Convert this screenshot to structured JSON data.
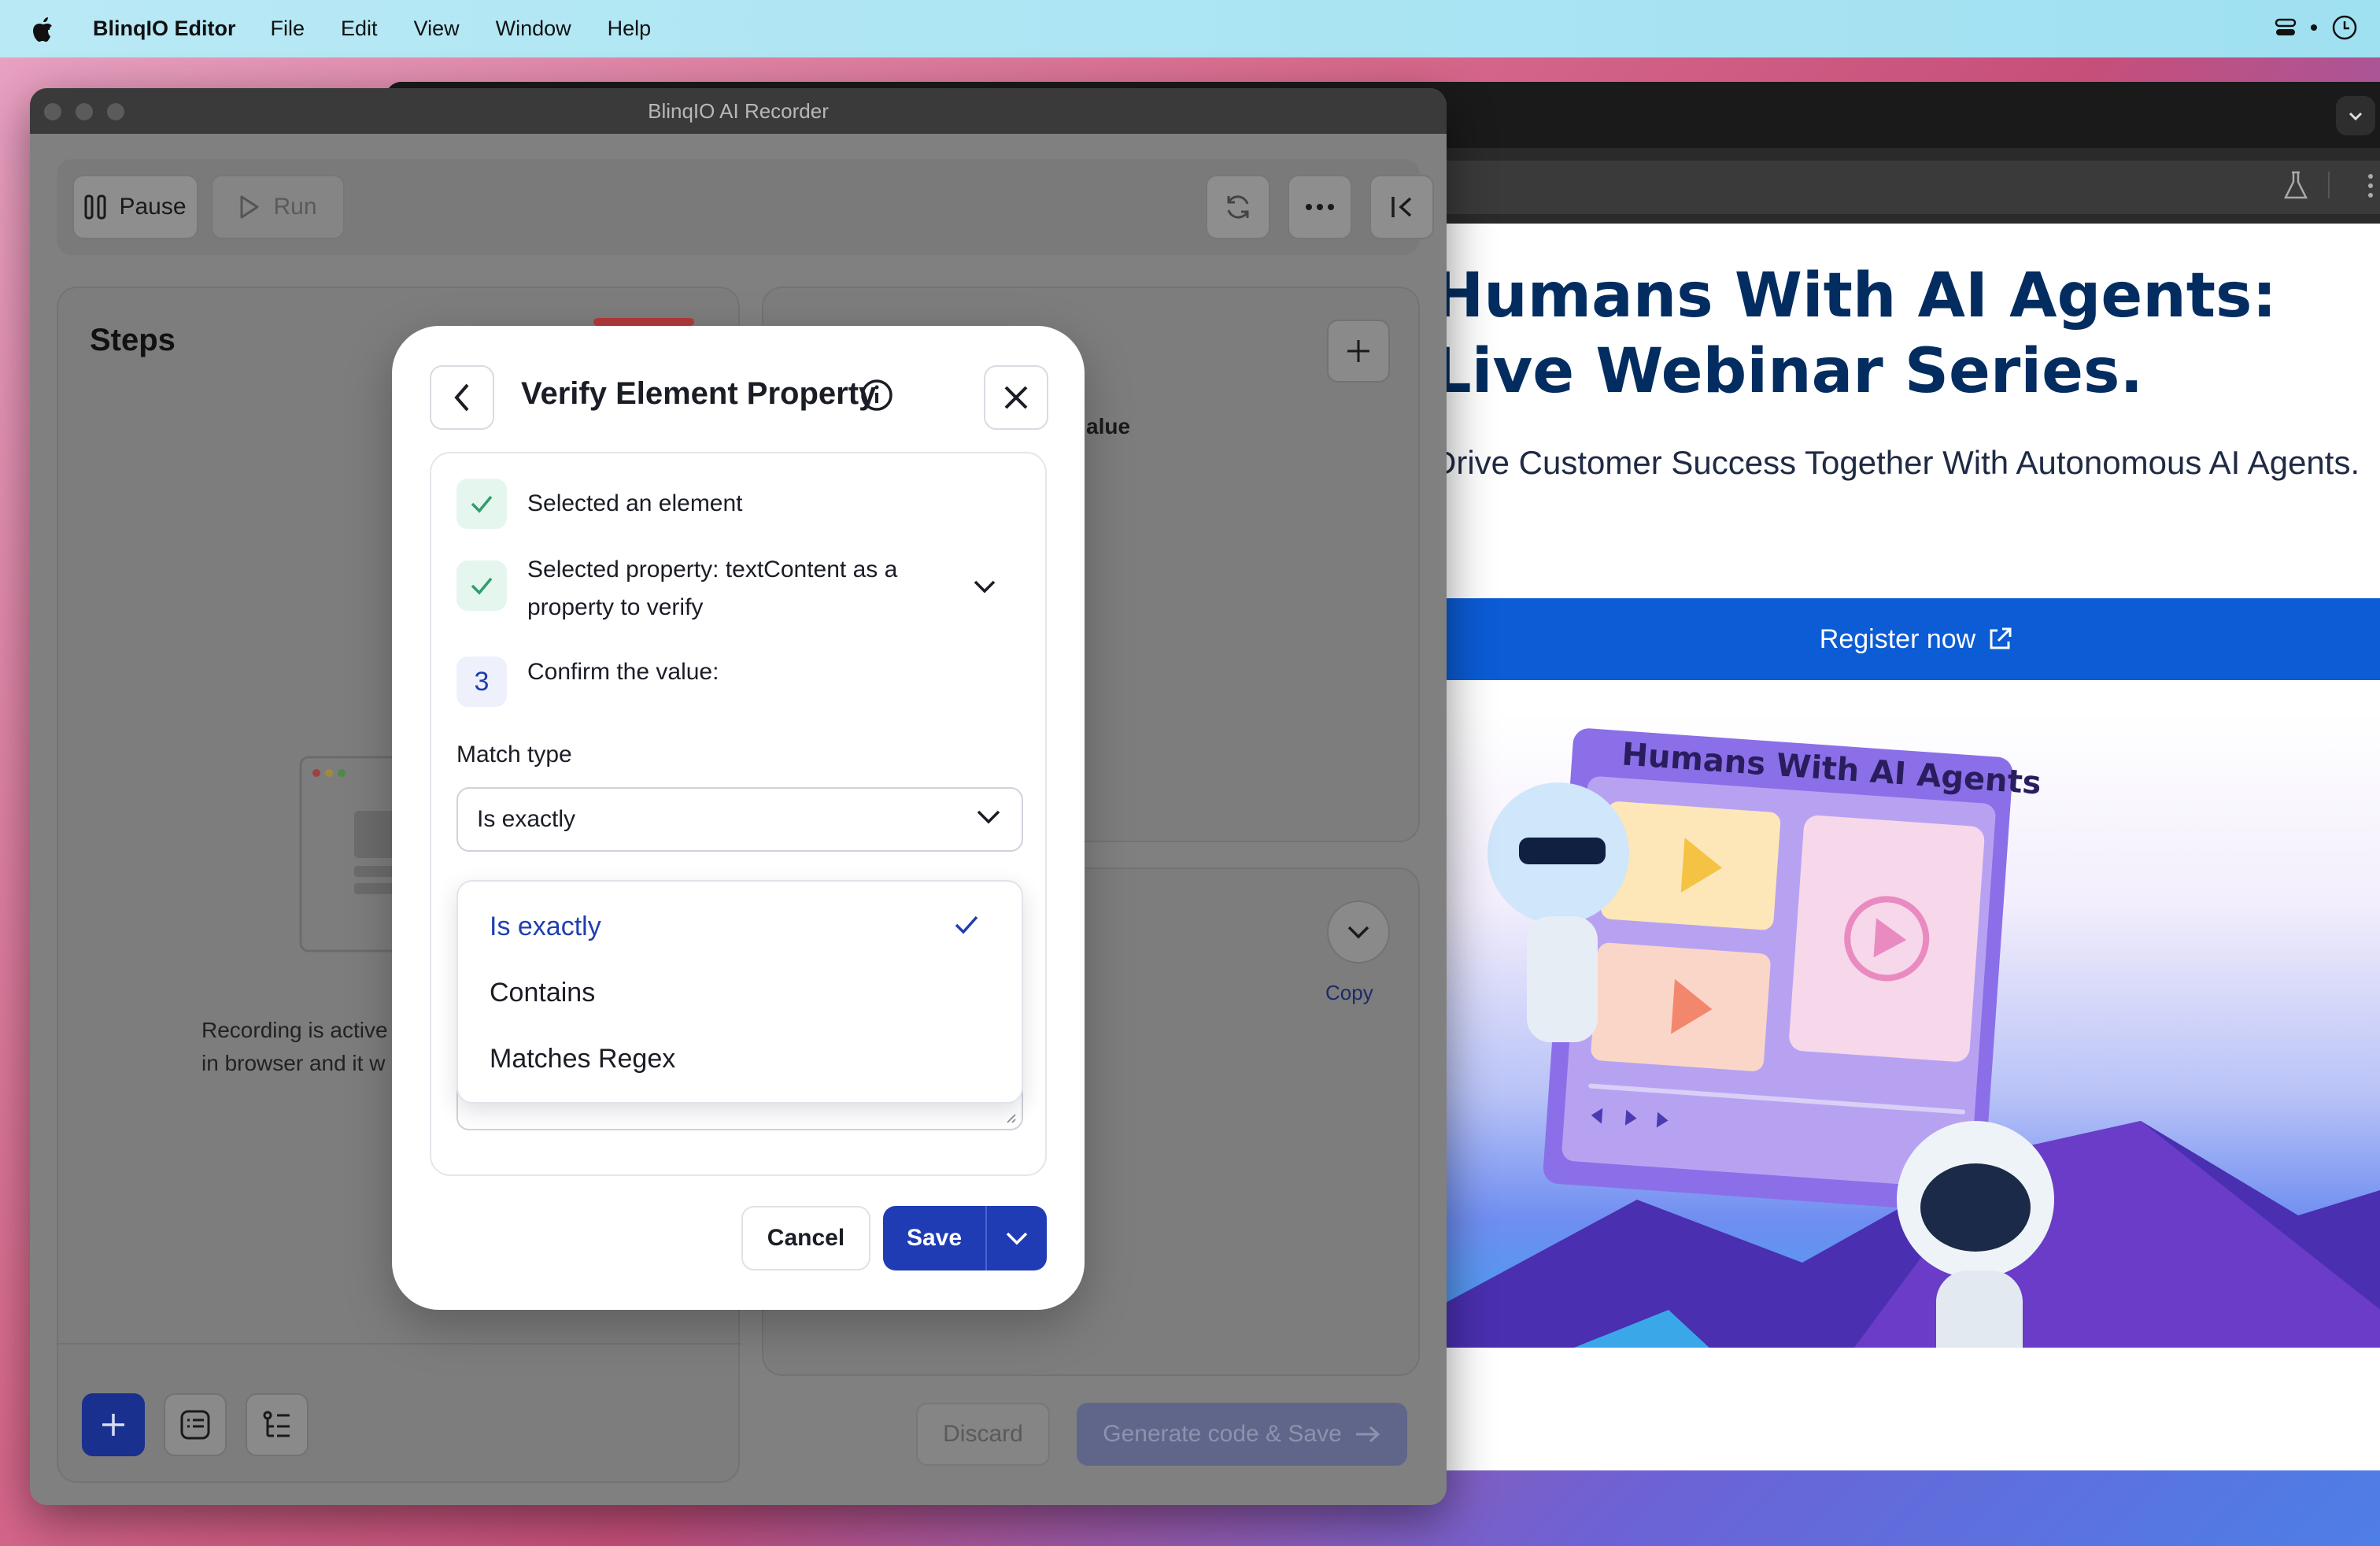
{
  "menubar": {
    "app_name": "BlinqIO Editor",
    "items": [
      "File",
      "Edit",
      "View",
      "Window",
      "Help"
    ]
  },
  "webpage": {
    "title": "Humans With AI Agents: Live Webinar Series.",
    "subtitle": "Drive Customer Success Together With Autonomous AI Agents.",
    "register_label": "Register now",
    "hero_caption": "Humans With AI Agents"
  },
  "recorder": {
    "window_title": "BlinqIO AI Recorder",
    "toolbar": {
      "pause_label": "Pause",
      "run_label": "Run"
    },
    "steps_title": "Steps",
    "empty_text_line1": "Recording is active",
    "empty_text_line2": "in browser and it w",
    "right_panel_fragment": "alue",
    "copy_label": "Copy",
    "discard_label": "Discard",
    "generate_label": "Generate code & Save"
  },
  "dialog": {
    "title": "Verify Element Property",
    "steps": [
      {
        "status": "done",
        "text": "Selected an element"
      },
      {
        "status": "done",
        "text_line1": "Selected property: textContent as a",
        "text_line2": "property to verify"
      },
      {
        "status": "current",
        "number": "3",
        "text": "Confirm the value:"
      }
    ],
    "match_type_label": "Match type",
    "match_type_value": "Is exactly",
    "options": [
      "Is exactly",
      "Contains",
      "Matches Regex"
    ],
    "selected_option": "Is exactly",
    "cancel_label": "Cancel",
    "save_label": "Save"
  },
  "colors": {
    "primary": "#1f3cb4",
    "selected_option": "#1f3fb0",
    "check_bg": "#e5f6ee",
    "check_mark": "#2e9e6b",
    "webpage_title": "#032d60",
    "register_button": "#0b5cd5"
  }
}
